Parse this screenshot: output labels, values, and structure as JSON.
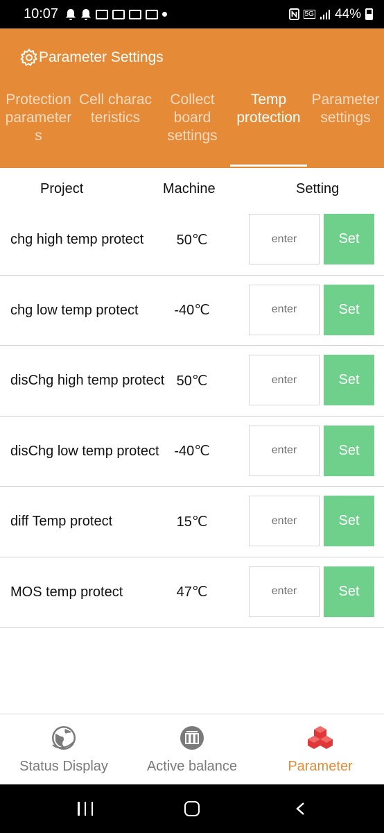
{
  "status_bar": {
    "time": "10:07",
    "network": "5G",
    "battery": "44%"
  },
  "header": {
    "title": "Parameter Settings"
  },
  "tabs": [
    {
      "label": "Protection parameter s",
      "lines": [
        "Protection",
        "parameter",
        "s"
      ],
      "active": false
    },
    {
      "label": "Cell charac teristics",
      "lines": [
        "Cell charac",
        "teristics"
      ],
      "active": false
    },
    {
      "label": "Collect board settings",
      "lines": [
        "Collect",
        "board",
        "settings"
      ],
      "active": false
    },
    {
      "label": "Temp protection",
      "lines": [
        "Temp",
        "protection"
      ],
      "active": true
    },
    {
      "label": "Parameter settings",
      "lines": [
        "Parameter",
        "settings"
      ],
      "active": false
    }
  ],
  "columns": {
    "project": "Project",
    "machine": "Machine",
    "setting": "Setting"
  },
  "rows": [
    {
      "name": "chg high temp protect",
      "value": "50℃",
      "placeholder": "enter",
      "button": "Set"
    },
    {
      "name": "chg low temp protect",
      "value": "-40℃",
      "placeholder": "enter",
      "button": "Set"
    },
    {
      "name": "disChg high temp protect",
      "value": "50℃",
      "placeholder": "enter",
      "button": "Set"
    },
    {
      "name": "disChg low temp protect",
      "value": "-40℃",
      "placeholder": "enter",
      "button": "Set"
    },
    {
      "name": "diff Temp protect",
      "value": "15℃",
      "placeholder": "enter",
      "button": "Set"
    },
    {
      "name": "MOS temp protect",
      "value": "47℃",
      "placeholder": "enter",
      "button": "Set"
    }
  ],
  "bottom_nav": [
    {
      "label": "Status Display",
      "icon": "globe-icon",
      "active": false
    },
    {
      "label": "Active balance",
      "icon": "balance-icon",
      "active": false
    },
    {
      "label": "Parameter",
      "icon": "cubes-icon",
      "active": true
    }
  ],
  "colors": {
    "accent": "#e58b38",
    "button": "#6fd08c"
  }
}
